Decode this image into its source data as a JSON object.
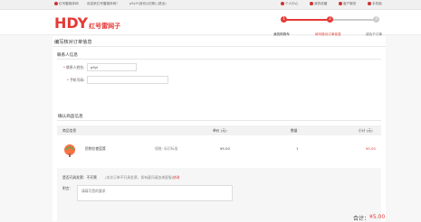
{
  "topbar": {
    "left_text": "红号雷媒体网",
    "welcome": "欢迎来红号雷媒体网！",
    "user": "p9yl*(身份)[切换] (退出)",
    "links": [
      "个人中心",
      "我的收藏",
      "客户服务",
      "手机版"
    ]
  },
  "logo": {
    "brand_main": "HDY",
    "brand_sub": "红号雷网子"
  },
  "steps": {
    "items": [
      {
        "num": "1",
        "label": "我的购物车",
        "state": "done"
      },
      {
        "num": "2",
        "label": "填写核对订单信息",
        "state": "active"
      },
      {
        "num": "3",
        "label": "成功下订单",
        "state": "todo"
      }
    ],
    "accent": "#e53935"
  },
  "page": {
    "title": "编写核对订单信息",
    "contact_title": "联系人信息",
    "name_label": "联系人姓名:",
    "name_value": "p9yl",
    "phone_label": "手机号码:",
    "phone_value": "",
    "goods_title": "确认商品信息"
  },
  "table": {
    "headers": [
      "商品信息",
      "单价 (元)",
      "数量",
      "小计 (元)"
    ],
    "rows": [
      {
        "name": "民物位使篮筐",
        "spec": "规格: 标识标准",
        "price": "¥5.00",
        "qty": "1",
        "subtotal": "¥5.00"
      }
    ]
  },
  "invoice": {
    "label": "是否开具发票：",
    "value": "不开票",
    "hint": "(本次订单不开具发票，如有疑问请咨询客服)",
    "modify": "修改"
  },
  "remark": {
    "label": "附言：",
    "placeholder": "请填写您的要求"
  },
  "summary": {
    "label": "合计：",
    "amount": "¥5.00"
  },
  "colors": {
    "accent": "#e53935",
    "done_step": "#e53935",
    "todo_step": "#cccccc"
  }
}
